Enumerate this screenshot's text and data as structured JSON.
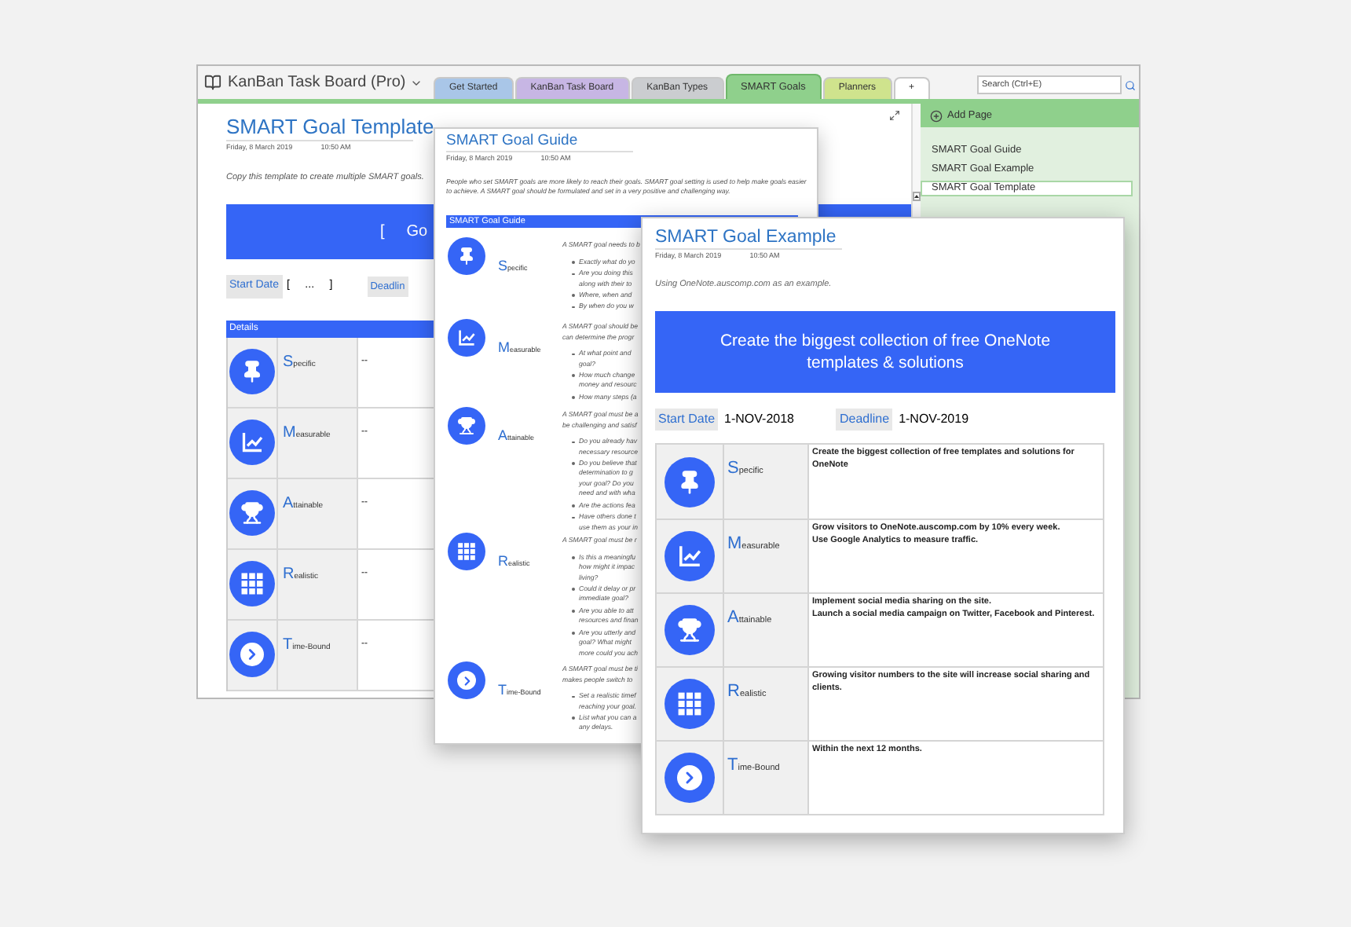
{
  "window": {
    "notebook": "KanBan Task Board (Pro)",
    "search": {
      "placeholder": "Search (Ctrl+E)"
    }
  },
  "tabs": [
    {
      "label": "Get Started",
      "selected": false,
      "color": "#a9c6e8"
    },
    {
      "label": "KanBan Task Board",
      "selected": false,
      "color": "#c7b6e4"
    },
    {
      "label": "KanBan Types",
      "selected": false,
      "color": "#cbcdd0"
    },
    {
      "label": "SMART Goals",
      "selected": true,
      "color": "#8fd08c"
    },
    {
      "label": "Planners",
      "selected": false,
      "color": "#cfe38d"
    },
    {
      "label": "+",
      "selected": false,
      "color": "#ffffff"
    }
  ],
  "pages_pane": {
    "add_page": "Add Page",
    "pages": [
      {
        "title": "SMART Goal Guide",
        "selected": false
      },
      {
        "title": "SMART Goal Example",
        "selected": false
      },
      {
        "title": "SMART Goal Template",
        "selected": true
      }
    ]
  },
  "template": {
    "title": "SMART Goal Template",
    "date": "Friday, 8 March 2019",
    "time": "10:50 AM",
    "intro": "Copy this template to create multiple SMART goals.",
    "banner": [
      "[",
      "Go"
    ],
    "start_label": "Start Date",
    "start_value": "[     ...     ]",
    "deadline_label": "Deadlin",
    "details_header": "Details",
    "rows": [
      {
        "label": "Specific",
        "kind": "pin",
        "value": "--"
      },
      {
        "label": "Measurable",
        "kind": "chart",
        "value": "--"
      },
      {
        "label": "Attainable",
        "kind": "trophy",
        "value": "--"
      },
      {
        "label": "Realistic",
        "kind": "grid",
        "value": "--"
      },
      {
        "label": "Time-Bound",
        "kind": "chevron",
        "value": "--"
      }
    ]
  },
  "guide": {
    "title": "SMART Goal Guide",
    "date": "Friday, 8 March 2019",
    "time": "10:50 AM",
    "intro": "People who set SMART goals are more likely to reach their goals. SMART goal setting is used to help make goals easier to achieve. A SMART goal should be formulated and set in a very positive and challenging way.",
    "header": "SMART Goal Guide",
    "rows": [
      {
        "label": "Specific",
        "kind": "pin",
        "intro": [
          "A SMART goal needs to b"
        ],
        "bullets": [
          [
            "Exactly what do yo"
          ],
          [
            "Are you doing this",
            "along with their to"
          ],
          [
            "Where, when and"
          ],
          [
            "By when do you w"
          ]
        ]
      },
      {
        "label": "Measurable",
        "kind": "chart",
        "intro": [
          "A SMART goal should be",
          "can determine the progr"
        ],
        "bullets": [
          [
            "At what point and",
            "goal?"
          ],
          [
            "How much change",
            "money and resourc"
          ],
          [
            "How many steps (a"
          ]
        ]
      },
      {
        "label": "Attainable",
        "kind": "trophy",
        "intro": [
          "A SMART goal must be a",
          "be challenging and satisf"
        ],
        "bullets": [
          [
            "Do you already hav",
            "necessary resource"
          ],
          [
            "Do you believe that",
            "determination to g",
            "your goal?  Do you",
            "need and with wha"
          ],
          [
            "Are the actions fea"
          ],
          [
            "Have others done t",
            "use them as your in"
          ]
        ]
      },
      {
        "label": "Realistic",
        "kind": "grid",
        "intro": [
          "A SMART goal must be r"
        ],
        "bullets": [
          [
            "Is this a meaningfu",
            "how might it impac",
            "living?"
          ],
          [
            "Could it delay or pr",
            "immediate  goal?"
          ],
          [
            "Are you able to att",
            "resources and finan"
          ],
          [
            "Are you utterly and",
            "goal?  What might",
            "more could you ach"
          ]
        ]
      },
      {
        "label": "Time-Bound",
        "kind": "chevron",
        "intro": [
          "A SMART goal must be ti",
          "makes people switch to"
        ],
        "bullets": [
          [
            "Set a realistic timef",
            "reaching your goal."
          ],
          [
            "List what you can a",
            "any delays."
          ]
        ]
      }
    ]
  },
  "example": {
    "title": "SMART Goal Example",
    "date": "Friday, 8 March 2019",
    "time": "10:50 AM",
    "intro": "Using OneNote.auscomp.com as an example.",
    "banner": "Create the biggest collection of free OneNote templates & solutions",
    "start_label": "Start Date",
    "start_value": "1-NOV-2018",
    "deadline_label": "Deadline",
    "deadline_value": "1-NOV-2019",
    "rows": [
      {
        "label": "Specific",
        "kind": "pin",
        "lines": [
          "Create the biggest collection of free templates and solutions for OneNote"
        ]
      },
      {
        "label": "Measurable",
        "kind": "chart",
        "lines": [
          "Grow visitors to OneNote.auscomp.com by 10% every week.",
          "Use Google Analytics to measure traffic."
        ]
      },
      {
        "label": "Attainable",
        "kind": "trophy",
        "lines": [
          "Implement social media sharing on the site.",
          "Launch a social media campaign on Twitter, Facebook and Pinterest."
        ]
      },
      {
        "label": "Realistic",
        "kind": "grid",
        "lines": [
          "Growing visitor numbers to the site will increase social sharing and clients."
        ]
      },
      {
        "label": "Time-Bound",
        "kind": "chevron",
        "lines": [
          "Within the next 12 months."
        ]
      }
    ]
  }
}
